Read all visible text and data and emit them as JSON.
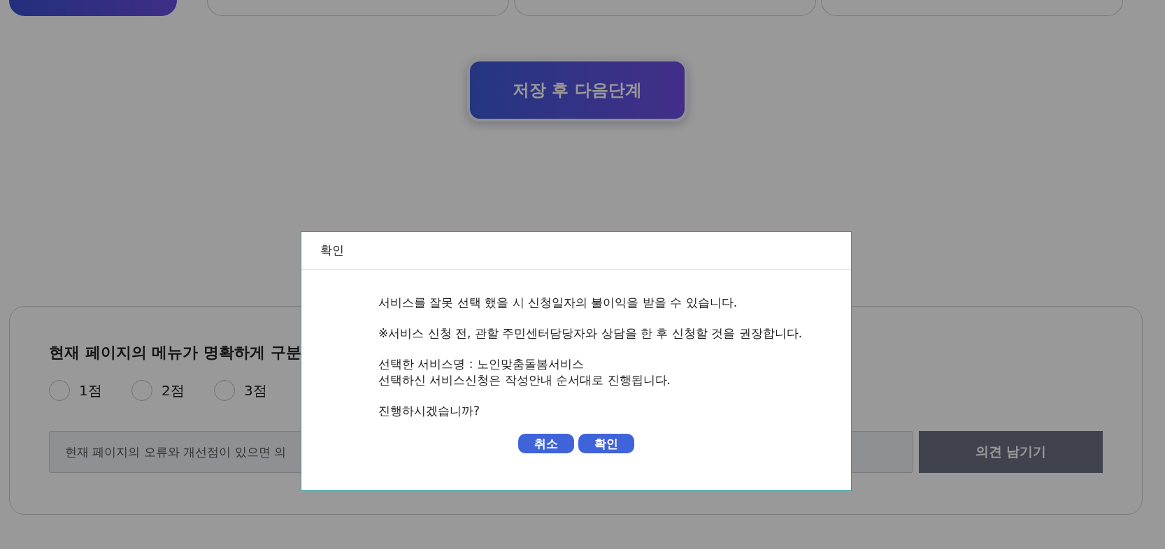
{
  "steps": [
    {
      "selected": true
    },
    {
      "selected": false
    },
    {
      "selected": false
    },
    {
      "selected": false
    }
  ],
  "save_button": {
    "label": "저장 후 다음단계"
  },
  "survey": {
    "question": "현재 페이지의 메뉴가 명확하게 구분",
    "options": [
      {
        "label": "1점",
        "selected": false
      },
      {
        "label": "2점",
        "selected": false
      },
      {
        "label": "3점",
        "selected": false
      }
    ],
    "comment": {
      "placeholder": "현재 페이지의 오류와 개선점이 있으면 의"
    },
    "submit": "의견 남기기"
  },
  "dialog": {
    "title": "확인",
    "paragraphs": [
      [
        "서비스를 잘못 선택 했을 시 신청일자의 불이익을 받을 수 있습니다."
      ],
      [
        "※서비스 신청 전, 관할 주민센터담당자와 상담을 한 후 신청할 것을 권장합니다."
      ],
      [
        "선택한 서비스명 : 노인맞춤돌봄서비스",
        "선택하신 서비스신청은 작성안내 순서대로 진행됩니다."
      ],
      [
        "진행하시겠습니까?"
      ]
    ],
    "buttons": [
      "취소",
      "확인"
    ]
  }
}
